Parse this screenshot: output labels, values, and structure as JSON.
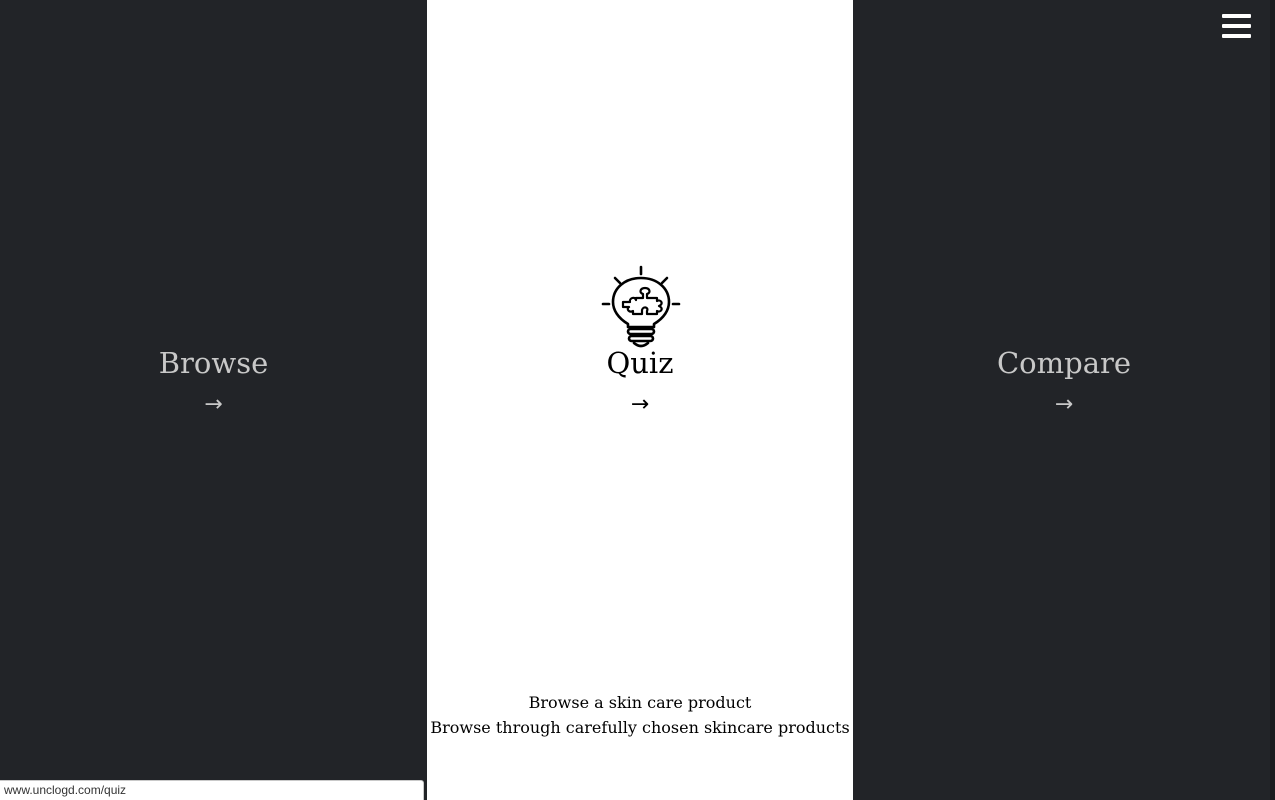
{
  "panels": {
    "browse": {
      "title": "Browse",
      "arrow": "→"
    },
    "quiz": {
      "title": "Quiz",
      "arrow": "→",
      "icon": "lightbulb-puzzle-icon",
      "description_line1": "Browse a skin care product",
      "description_line2": "Browse through carefully chosen skincare products"
    },
    "compare": {
      "title": "Compare",
      "arrow": "→"
    }
  },
  "menu": {
    "icon": "hamburger-menu-icon"
  },
  "status_bar": {
    "url": "www.unclogd.com/quiz"
  },
  "colors": {
    "dark_panel": "#222428",
    "light_panel": "#ffffff",
    "muted_text": "#c8c8c8",
    "dark_text": "#000000"
  }
}
